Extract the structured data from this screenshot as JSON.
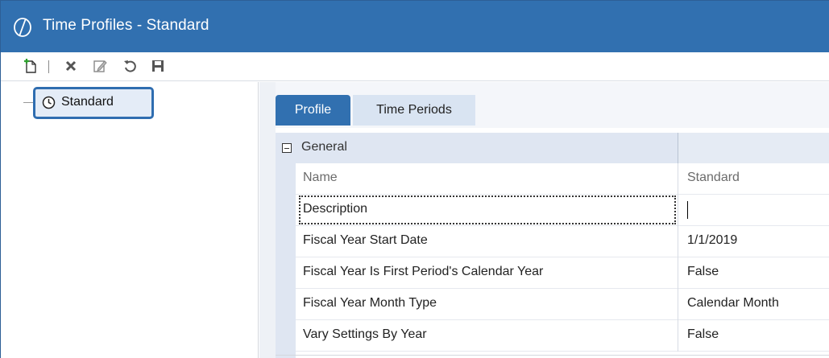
{
  "window": {
    "title": "Time Profiles - Standard",
    "accent_color": "#3170b0"
  },
  "toolbar": {
    "buttons": [
      {
        "icon": "new-document-icon"
      },
      {
        "icon": "delete-icon"
      },
      {
        "icon": "edit-icon"
      },
      {
        "icon": "refresh-icon"
      },
      {
        "icon": "save-icon"
      }
    ]
  },
  "tree": {
    "selected_node": {
      "label": "Standard",
      "icon": "clock-icon"
    }
  },
  "tabs": [
    {
      "label": "Profile",
      "active": true
    },
    {
      "label": "Time Periods",
      "active": false
    }
  ],
  "grid": {
    "category": "General",
    "rows": [
      {
        "name": "Name",
        "value": "Standard",
        "readonly": true
      },
      {
        "name": "Description",
        "value": "",
        "focused": true
      },
      {
        "name": "Fiscal Year Start Date",
        "value": "1/1/2019"
      },
      {
        "name": "Fiscal Year Is First Period's Calendar Year",
        "value": "False"
      },
      {
        "name": "Fiscal Year Month Type",
        "value": "Calendar Month"
      },
      {
        "name": "Vary Settings By Year",
        "value": "False"
      }
    ]
  }
}
